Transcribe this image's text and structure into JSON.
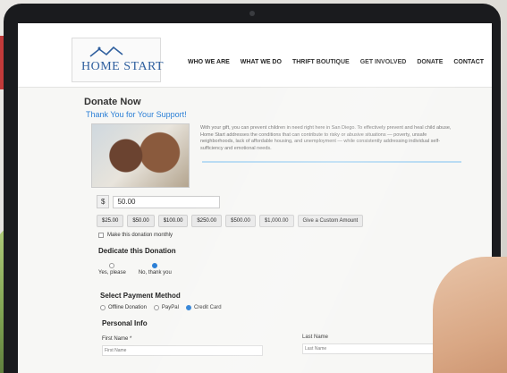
{
  "site": {
    "logo_text": "HOME START"
  },
  "nav": {
    "items": [
      "WHO WE ARE",
      "WHAT WE DO",
      "THRIFT BOUTIQUE",
      "GET INVOLVED",
      "DONATE",
      "CONTACT"
    ]
  },
  "page": {
    "title": "Donate Now",
    "subtitle": "Thank You for Your Support!",
    "blurb": "With your gift, you can prevent children in need right here in San Diego. To effectively prevent and heal child abuse, Home Start addresses the conditions that can contribute to risky or abusive situations — poverty, unsafe neighborhoods, lack of affordable housing, and unemployment — while consistently addressing individual self-sufficiency and emotional needs."
  },
  "donation": {
    "currency_symbol": "$",
    "amount_value": "50.00",
    "presets": [
      "$25.00",
      "$50.00",
      "$100.00",
      "$250.00",
      "$500.00",
      "$1,000.00",
      "Give a Custom Amount"
    ],
    "monthly_label": "Make this donation monthly"
  },
  "dedicate": {
    "heading": "Dedicate this Donation",
    "options": [
      {
        "label": "Yes, please",
        "selected": false
      },
      {
        "label": "No, thank you",
        "selected": true
      }
    ]
  },
  "payment": {
    "heading": "Select Payment Method",
    "options": [
      {
        "label": "Offline Donation",
        "selected": false
      },
      {
        "label": "PayPal",
        "selected": false
      },
      {
        "label": "Credit Card",
        "selected": true
      }
    ]
  },
  "personal": {
    "heading": "Personal Info",
    "first_name_label": "First Name *",
    "first_name_placeholder": "First Name",
    "last_name_label": "Last Name",
    "last_name_placeholder": "Last Name"
  },
  "colors": {
    "accent": "#2b7fd6",
    "logo": "#2f5f9e",
    "bezel": "#1a1b1e"
  }
}
